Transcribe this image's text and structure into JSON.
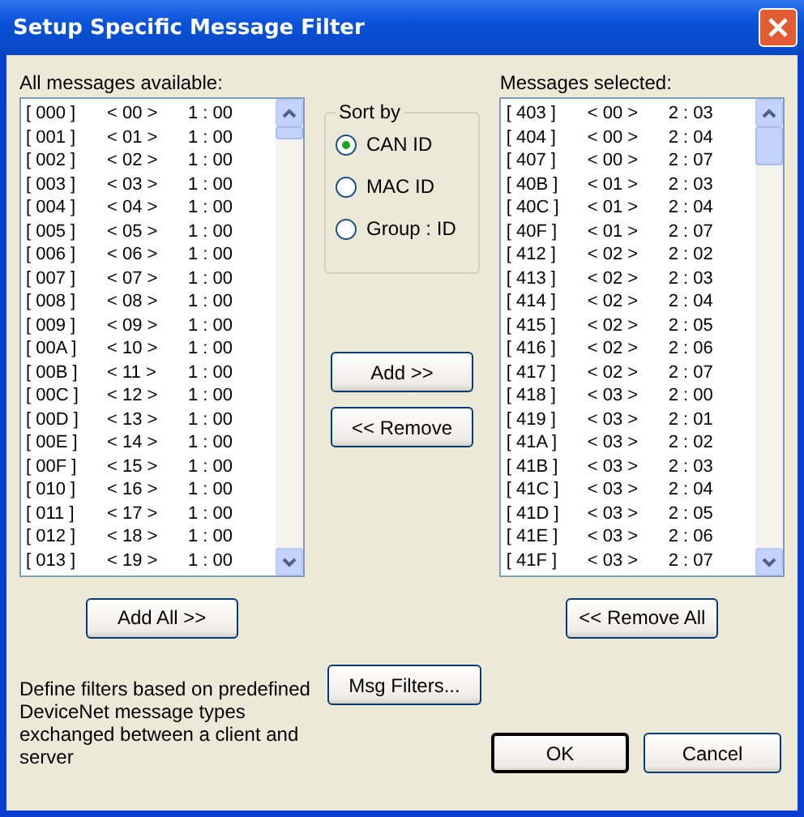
{
  "window": {
    "title": "Setup Specific Message Filter"
  },
  "available": {
    "label": "All messages available:",
    "rows": [
      {
        "id": "[ 000 ]",
        "node": "< 00 >",
        "group": "1 : 00"
      },
      {
        "id": "[ 001 ]",
        "node": "< 01 >",
        "group": "1 : 00"
      },
      {
        "id": "[ 002 ]",
        "node": "< 02 >",
        "group": "1 : 00"
      },
      {
        "id": "[ 003 ]",
        "node": "< 03 >",
        "group": "1 : 00"
      },
      {
        "id": "[ 004 ]",
        "node": "< 04 >",
        "group": "1 : 00"
      },
      {
        "id": "[ 005 ]",
        "node": "< 05 >",
        "group": "1 : 00"
      },
      {
        "id": "[ 006 ]",
        "node": "< 06 >",
        "group": "1 : 00"
      },
      {
        "id": "[ 007 ]",
        "node": "< 07 >",
        "group": "1 : 00"
      },
      {
        "id": "[ 008 ]",
        "node": "< 08 >",
        "group": "1 : 00"
      },
      {
        "id": "[ 009 ]",
        "node": "< 09 >",
        "group": "1 : 00"
      },
      {
        "id": "[ 00A ]",
        "node": "< 10 >",
        "group": "1 : 00"
      },
      {
        "id": "[ 00B ]",
        "node": "< 11 >",
        "group": "1 : 00"
      },
      {
        "id": "[ 00C ]",
        "node": "< 12 >",
        "group": "1 : 00"
      },
      {
        "id": "[ 00D ]",
        "node": "< 13 >",
        "group": "1 : 00"
      },
      {
        "id": "[ 00E ]",
        "node": "< 14 >",
        "group": "1 : 00"
      },
      {
        "id": "[ 00F ]",
        "node": "< 15 >",
        "group": "1 : 00"
      },
      {
        "id": "[ 010 ]",
        "node": "< 16 >",
        "group": "1 : 00"
      },
      {
        "id": "[ 011 ]",
        "node": "< 17 >",
        "group": "1 : 00"
      },
      {
        "id": "[ 012 ]",
        "node": "< 18 >",
        "group": "1 : 00"
      },
      {
        "id": "[ 013 ]",
        "node": "< 19 >",
        "group": "1 : 00"
      }
    ]
  },
  "sort_by": {
    "label": "Sort by",
    "options": [
      {
        "label": "CAN ID",
        "selected": true
      },
      {
        "label": "MAC ID",
        "selected": false
      },
      {
        "label": "Group : ID",
        "selected": false
      }
    ]
  },
  "add_button": "Add >>",
  "remove_button": "<< Remove",
  "selected_list": {
    "label": "Messages selected:",
    "rows": [
      {
        "id": "[ 403 ]",
        "node": "< 00 >",
        "group": "2 : 03"
      },
      {
        "id": "[ 404 ]",
        "node": "< 00 >",
        "group": "2 : 04"
      },
      {
        "id": "[ 407 ]",
        "node": "< 00 >",
        "group": "2 : 07"
      },
      {
        "id": "[ 40B ]",
        "node": "< 01 >",
        "group": "2 : 03"
      },
      {
        "id": "[ 40C ]",
        "node": "< 01 >",
        "group": "2 : 04"
      },
      {
        "id": "[ 40F ]",
        "node": "< 01 >",
        "group": "2 : 07"
      },
      {
        "id": "[ 412 ]",
        "node": "< 02 >",
        "group": "2 : 02"
      },
      {
        "id": "[ 413 ]",
        "node": "< 02 >",
        "group": "2 : 03"
      },
      {
        "id": "[ 414 ]",
        "node": "< 02 >",
        "group": "2 : 04"
      },
      {
        "id": "[ 415 ]",
        "node": "< 02 >",
        "group": "2 : 05"
      },
      {
        "id": "[ 416 ]",
        "node": "< 02 >",
        "group": "2 : 06"
      },
      {
        "id": "[ 417 ]",
        "node": "< 02 >",
        "group": "2 : 07"
      },
      {
        "id": "[ 418 ]",
        "node": "< 03 >",
        "group": "2 : 00"
      },
      {
        "id": "[ 419 ]",
        "node": "< 03 >",
        "group": "2 : 01"
      },
      {
        "id": "[ 41A ]",
        "node": "< 03 >",
        "group": "2 : 02"
      },
      {
        "id": "[ 41B ]",
        "node": "< 03 >",
        "group": "2 : 03"
      },
      {
        "id": "[ 41C ]",
        "node": "< 03 >",
        "group": "2 : 04"
      },
      {
        "id": "[ 41D ]",
        "node": "< 03 >",
        "group": "2 : 05"
      },
      {
        "id": "[ 41E ]",
        "node": "< 03 >",
        "group": "2 : 06"
      },
      {
        "id": "[ 41F ]",
        "node": "< 03 >",
        "group": "2 : 07"
      }
    ]
  },
  "add_all_button": "Add All >>",
  "remove_all_button": "<< Remove All",
  "hint": "Define filters based on predefined DeviceNet message types exchanged between a client and server",
  "msg_filters_button": "Msg Filters...",
  "buttons": [
    {
      "label": "OK",
      "kind": "default"
    },
    {
      "label": "Cancel",
      "kind": "normal"
    }
  ]
}
